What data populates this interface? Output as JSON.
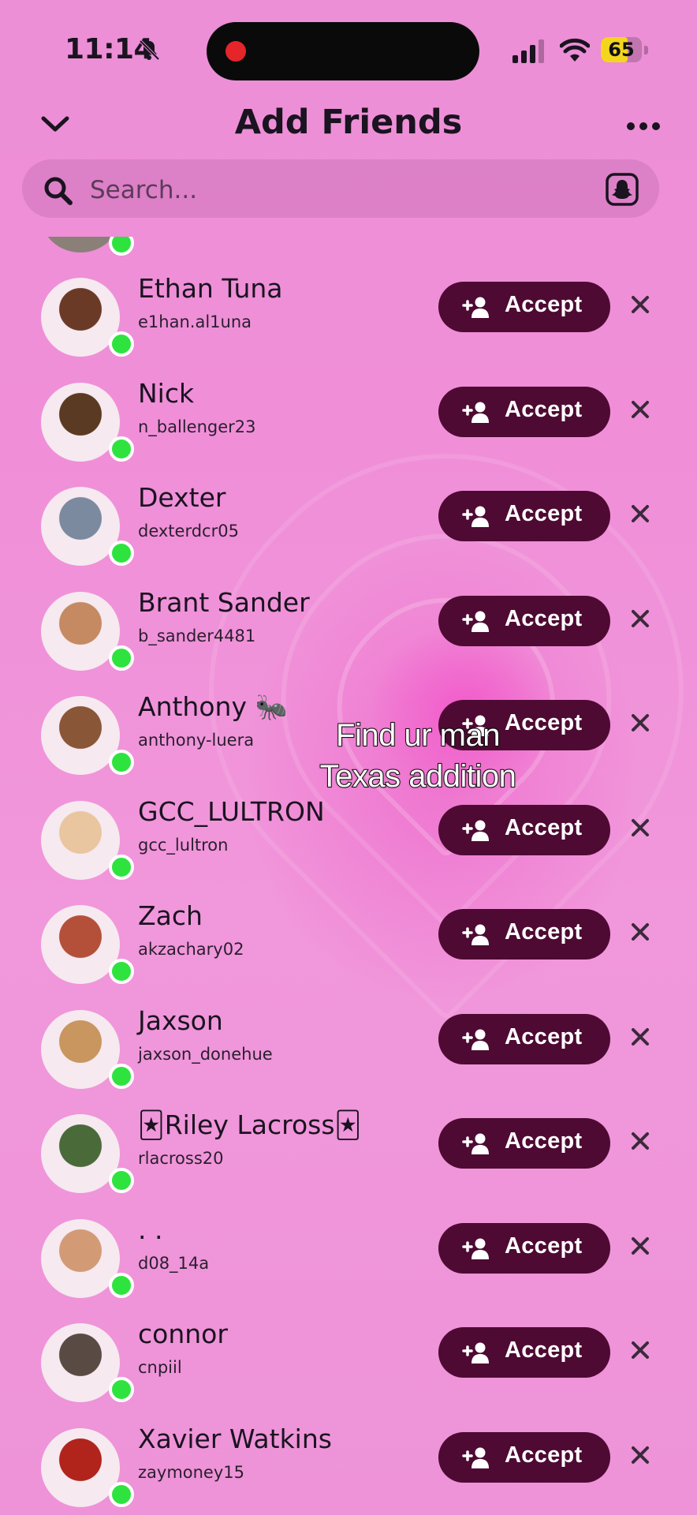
{
  "status": {
    "time": "11:14",
    "battery": "65",
    "battery_level": 0.65
  },
  "header": {
    "title": "Add Friends"
  },
  "search": {
    "placeholder": "Search..."
  },
  "accept_label": "Accept",
  "rows": [
    {
      "name": "Ethan Tuna",
      "username": "e1han.al1una",
      "avatar_color": "#6b3a26"
    },
    {
      "name": "Nick",
      "username": "n_ballenger23",
      "avatar_color": "#5a3a22"
    },
    {
      "name": "Dexter",
      "username": "dexterdcr05",
      "avatar_color": "#7c8aa0"
    },
    {
      "name": "Brant Sander",
      "username": "b_sander4481",
      "avatar_color": "#c58a62"
    },
    {
      "name": "Anthony 🐜",
      "username": "anthony-luera",
      "avatar_color": "#8a5638"
    },
    {
      "name": "GCC_LULTRON",
      "username": "gcc_lultron",
      "avatar_color": "#e9c6a0"
    },
    {
      "name": "Zach",
      "username": "akzachary02",
      "avatar_color": "#b4503a"
    },
    {
      "name": "Jaxson",
      "username": "jaxson_donehue",
      "avatar_color": "#c8965e"
    },
    {
      "name": "🃏Riley Lacross🃏",
      "username": "rlacross20",
      "avatar_color": "#4a6a3a"
    },
    {
      "name": ". .",
      "username": "d08_14a",
      "avatar_color": "#d39a76"
    },
    {
      "name": "connor",
      "username": "cnpiil",
      "avatar_color": "#5a4a44"
    },
    {
      "name": "Xavier Watkins",
      "username": "zaymoney15",
      "avatar_color": "#b0241c"
    }
  ],
  "caption": {
    "line1": "Find ur man",
    "line2": "Texas addition"
  },
  "icons": {
    "bell": "bell-slash-icon",
    "signal": "signal-icon",
    "wifi": "wifi-icon",
    "back": "chevron-down-icon",
    "more": "more-icon",
    "search": "search-icon",
    "ghost": "snapcode-icon",
    "accept": "add-friend-icon",
    "dismiss": "close-icon"
  }
}
